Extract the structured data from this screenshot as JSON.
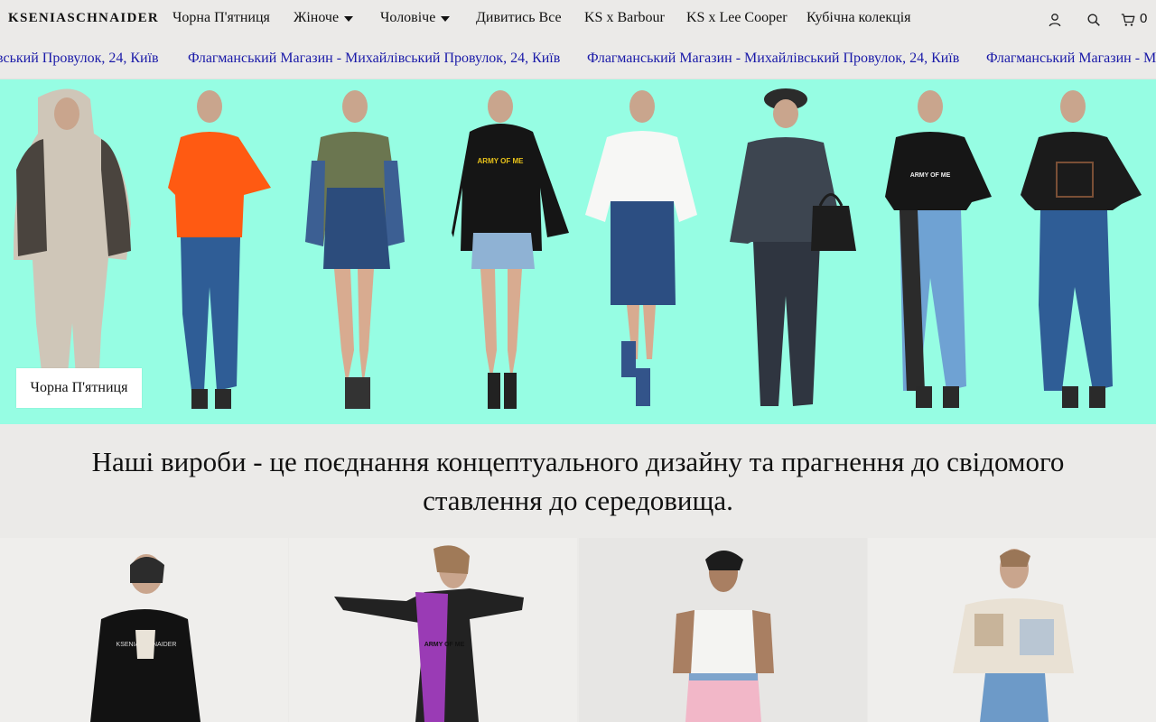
{
  "brand": {
    "logo": "KSENIASCHNAIDER"
  },
  "nav": {
    "items": [
      {
        "label": "Чорна П'ятниця",
        "dropdown": false
      },
      {
        "label": "Жіноче",
        "dropdown": true
      },
      {
        "label": "Чоловіче",
        "dropdown": true
      },
      {
        "label": "Дивитись Все",
        "dropdown": false
      },
      {
        "label": "KS x Barbour",
        "dropdown": false
      },
      {
        "label": "KS x Lee Cooper",
        "dropdown": false
      },
      {
        "label": "Кубічна колекція",
        "dropdown": false
      }
    ]
  },
  "header_icons": {
    "account": "user-icon",
    "search": "search-icon",
    "cart": "cart-icon",
    "cart_count": "0"
  },
  "marquee": {
    "items": [
      "вський Провулок, 24, Київ",
      "Флагманський Магазин - Михайлівський Провулок, 24, Київ",
      "Флагманський Магазин - Михайлівський Провулок, 24, Київ",
      "Флагманський Магазин - М"
    ],
    "color": "#1a1aa8"
  },
  "hero": {
    "background": "#96fde3",
    "button_label": "Чорна П'ятниця",
    "print_text": "ARMY OF ME"
  },
  "tagline": {
    "text": "Наші вироби - це поєднання концептуального дизайну та прагнення до свідомого ставлення до середовища."
  },
  "products": {
    "cards": [
      {
        "image": "black-hoodie-photo",
        "print": "KSENIASCHNAIDER"
      },
      {
        "image": "lace-dress-photo",
        "print": "ARMY OF ME"
      },
      {
        "image": "white-tank-photo"
      },
      {
        "image": "patchwork-jacket-photo"
      }
    ]
  }
}
